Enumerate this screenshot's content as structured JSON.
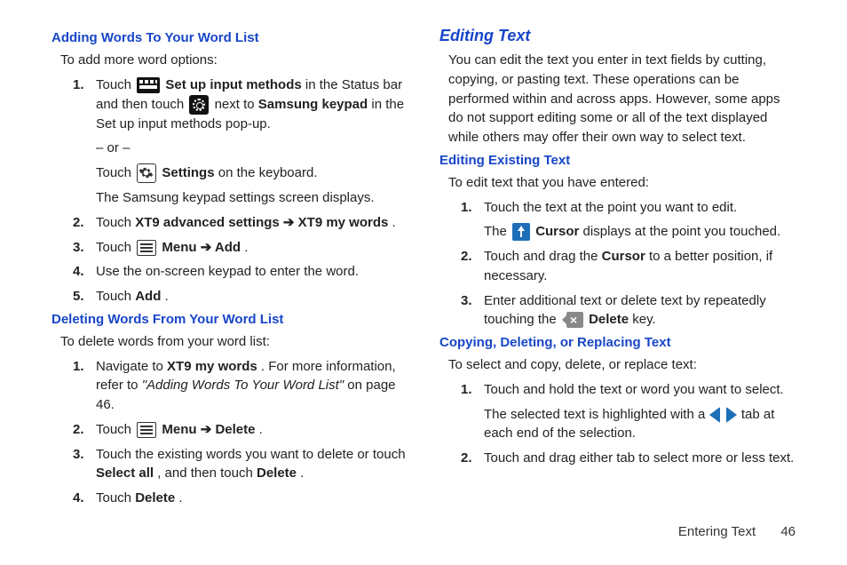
{
  "left": {
    "h1": "Adding Words To Your Word List",
    "intro1": "To add more word options:",
    "s1": {
      "li1_a": "Touch ",
      "li1_b": " Set up input methods",
      "li1_c": " in the Status bar and then touch ",
      "li1_d": " next to ",
      "li1_e": "Samsung keypad",
      "li1_f": " in the Set up input methods pop-up.",
      "or": "– or –",
      "touch": "Touch ",
      "settings": " Settings",
      "settings_after": " on the keyboard.",
      "result": "The Samsung keypad settings screen displays.",
      "li2_a": "Touch ",
      "li2_b": "XT9 advanced settings ➔ XT9 my words",
      "li2_c": ".",
      "li3_a": "Touch ",
      "li3_b": " Menu ➔ Add",
      "li3_c": ".",
      "li4": "Use the on-screen keypad to enter the word.",
      "li5_a": "Touch ",
      "li5_b": "Add",
      "li5_c": "."
    },
    "h2": "Deleting Words From Your Word List",
    "intro2": "To delete words from your word list:",
    "s2": {
      "li1_a": "Navigate to ",
      "li1_b": "XT9 my words",
      "li1_c": ". For more information, refer to ",
      "li1_d": "\"Adding Words To Your Word List\"",
      "li1_e": " on page 46.",
      "li2_a": "Touch ",
      "li2_b": " Menu ➔ Delete",
      "li2_c": ".",
      "li3_a": "Touch the existing words you want to delete or touch ",
      "li3_b": "Select all",
      "li3_c": ", and then touch ",
      "li3_d": "Delete",
      "li3_e": ".",
      "li4_a": "Touch ",
      "li4_b": "Delete",
      "li4_c": "."
    }
  },
  "right": {
    "h1": "Editing Text",
    "intro": "You can edit the text you enter in text fields by cutting, copying, or pasting text. These operations can be performed within and across apps. However, some apps do not support editing some or all of the text displayed while others may offer their own way to select text.",
    "h2": "Editing Existing Text",
    "intro2": "To edit text that you have entered:",
    "s1": {
      "li1": "Touch the text at the point you want to edit.",
      "li1_sub_a": "The ",
      "li1_sub_b": " Cursor",
      "li1_sub_c": " displays at the point you touched.",
      "li2_a": "Touch and drag the ",
      "li2_b": "Cursor",
      "li2_c": " to a better position, if necessary.",
      "li3_a": "Enter additional text or delete text by repeatedly touching the ",
      "li3_b": " Delete",
      "li3_c": " key."
    },
    "h3": "Copying, Deleting, or Replacing Text",
    "intro3": "To select and copy, delete, or replace text:",
    "s2": {
      "li1_a": "Touch and hold the text or word you want to select.",
      "li1_sub_a": "The selected text is highlighted with a ",
      "li1_sub_b": " tab at each end of the selection.",
      "li2": "Touch and drag either tab to select more or less text."
    }
  },
  "footer": {
    "section": "Entering Text",
    "page": "46"
  }
}
